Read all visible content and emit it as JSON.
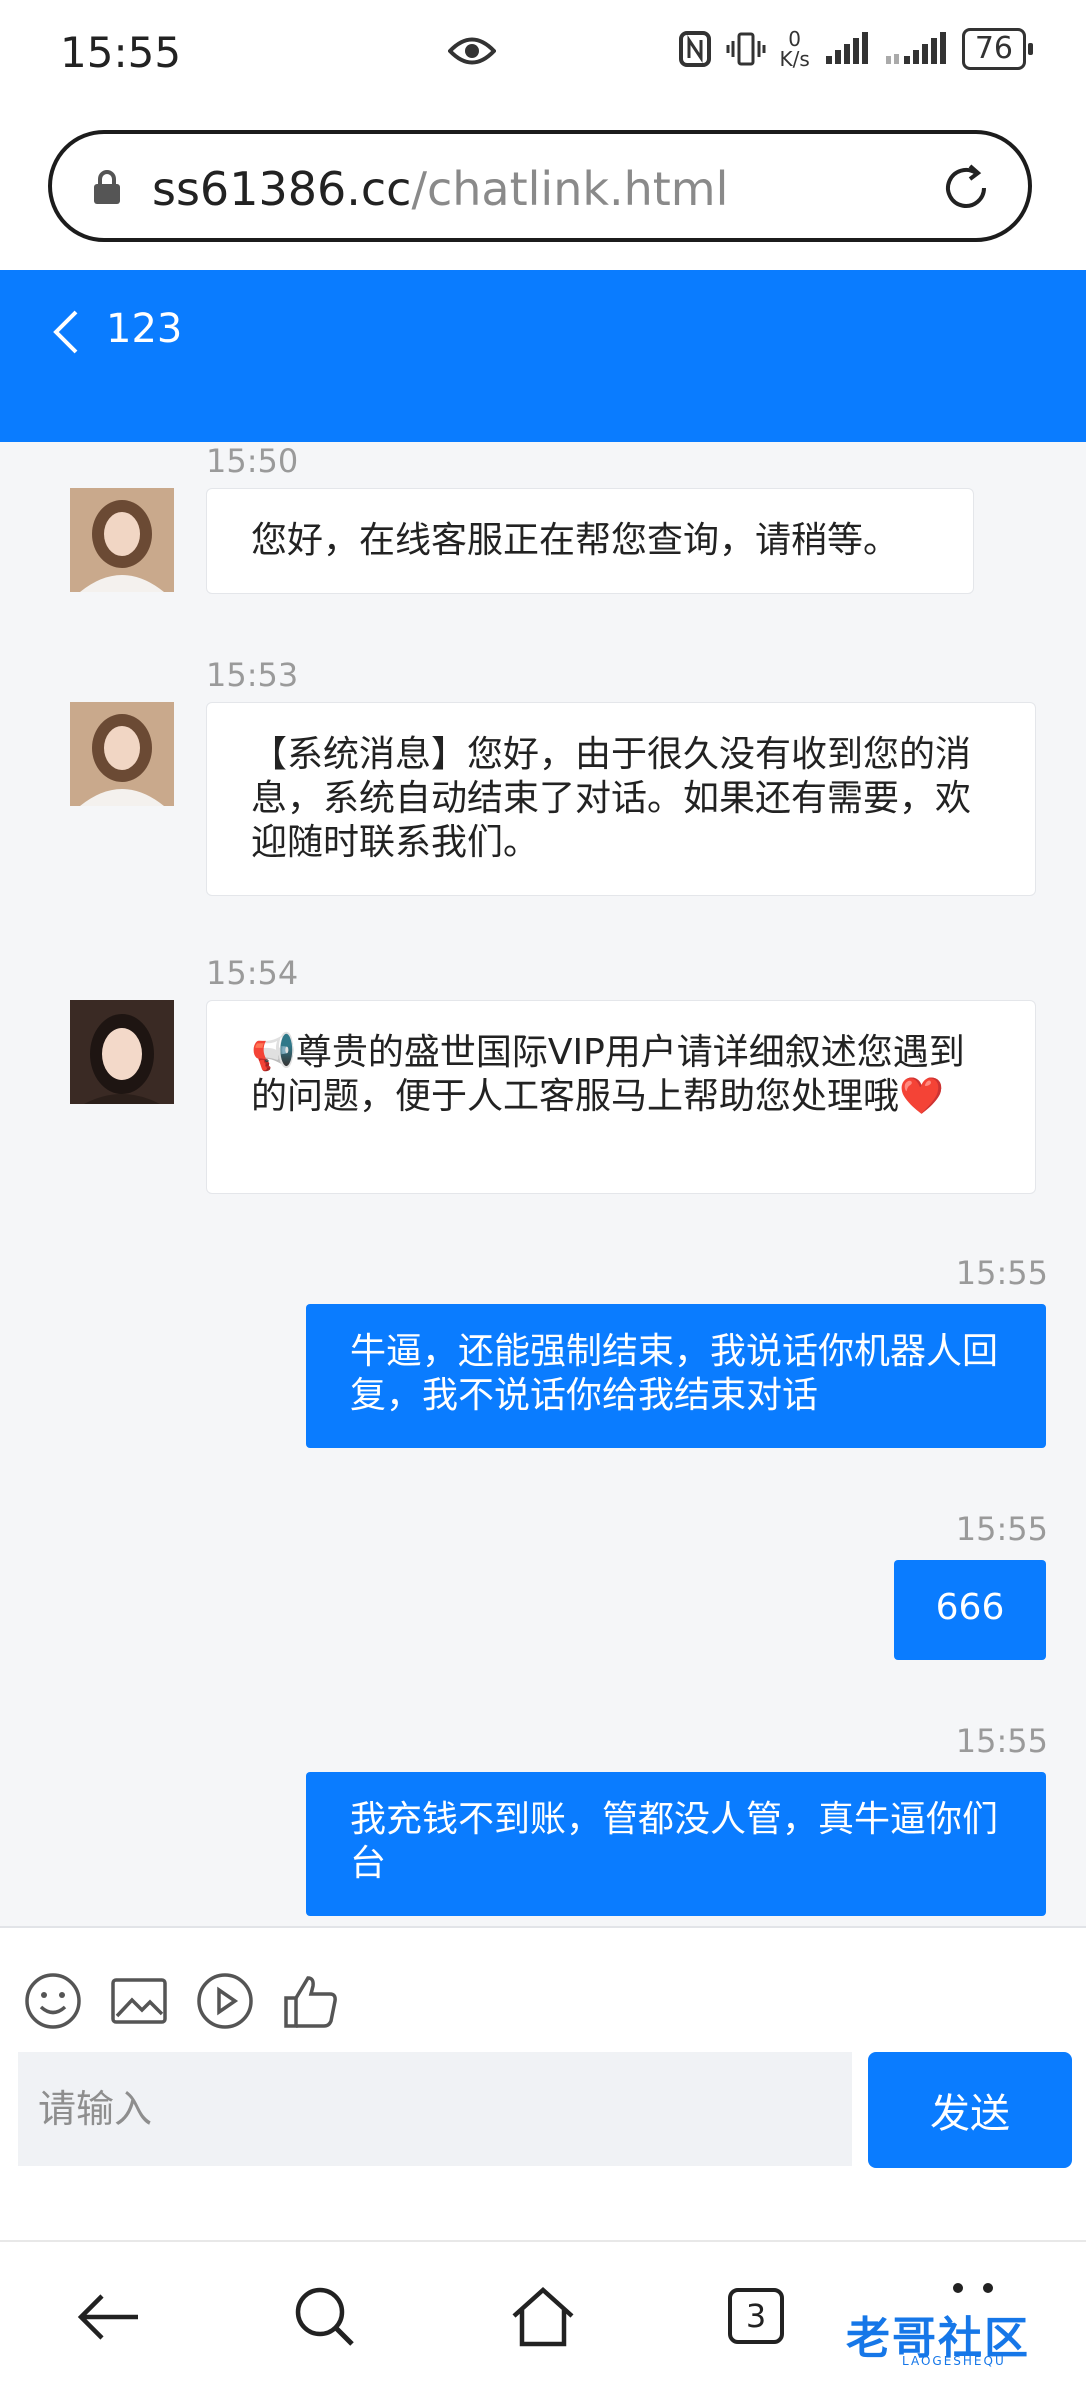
{
  "status_bar": {
    "time": "15:55",
    "net_speed": "0",
    "net_unit": "K/s",
    "battery": "76"
  },
  "browser": {
    "url_host": "ss61386.cc",
    "url_path": "/chatlink.html",
    "tabs_count": "3"
  },
  "chat": {
    "title": "123",
    "messages": [
      {
        "time": "15:50",
        "text": "您好，在线客服正在帮您查询，请稍等。"
      },
      {
        "time": "15:53",
        "text": "【系统消息】您好，由于很久没有收到您的消息，系统自动结束了对话。如果还有需要，欢迎随时联系我们。"
      },
      {
        "time": "15:54",
        "text": "📢尊贵的盛世国际VIP用户请详细叙述您遇到的问题，便于人工客服马上帮助您处理哦❤️"
      },
      {
        "time": "15:55",
        "text": "牛逼，还能强制结束，我说话你机器人回复，我不说话你给我结束对话"
      },
      {
        "time": "15:55",
        "text": "666"
      },
      {
        "time": "15:55",
        "text": "我充钱不到账，管都没人管，真牛逼你们台"
      }
    ]
  },
  "composer": {
    "placeholder": "请输入",
    "send_label": "发送"
  },
  "watermark": {
    "main": "老哥社区",
    "sub": "LAOGESHEQU"
  },
  "colors": {
    "accent": "#0a7cff",
    "background": "#f5f6f8"
  }
}
